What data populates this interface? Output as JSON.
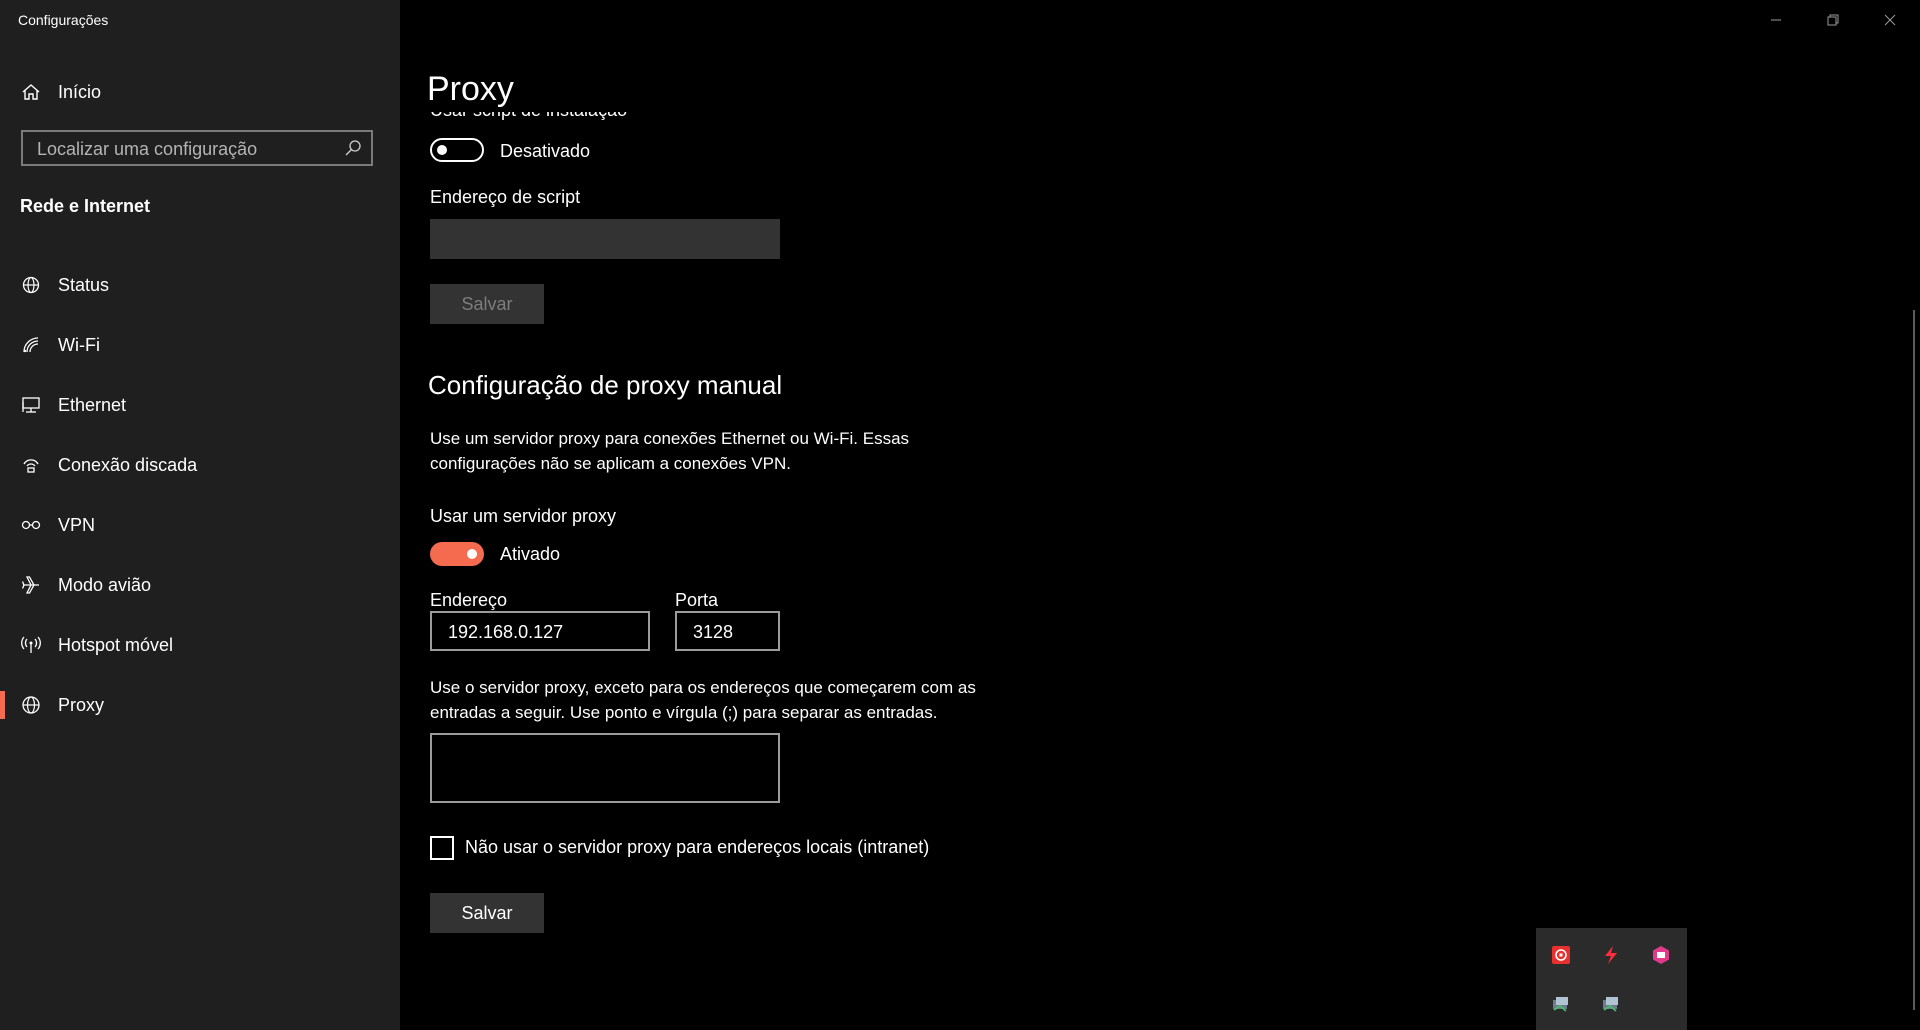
{
  "window": {
    "title": "Configurações"
  },
  "sidebar": {
    "home_label": "Início",
    "search_placeholder": "Localizar uma configuração",
    "section_title": "Rede e Internet",
    "items": [
      {
        "label": "Status",
        "icon": "globe-status-icon"
      },
      {
        "label": "Wi-Fi",
        "icon": "wifi-icon"
      },
      {
        "label": "Ethernet",
        "icon": "ethernet-icon"
      },
      {
        "label": "Conexão discada",
        "icon": "dialup-icon"
      },
      {
        "label": "VPN",
        "icon": "vpn-icon"
      },
      {
        "label": "Modo avião",
        "icon": "airplane-icon"
      },
      {
        "label": "Hotspot móvel",
        "icon": "hotspot-icon"
      },
      {
        "label": "Proxy",
        "icon": "globe-icon",
        "active": true
      }
    ]
  },
  "content": {
    "page_title": "Proxy",
    "script": {
      "clipped_label": "Usar script de instalação",
      "toggle_state": "Desativado",
      "address_label": "Endereço de script",
      "address_value": "",
      "save_label": "Salvar"
    },
    "manual": {
      "heading": "Configuração de proxy manual",
      "description": "Use um servidor proxy para conexões Ethernet ou Wi-Fi. Essas configurações não se aplicam a conexões VPN.",
      "use_proxy_label": "Usar um servidor proxy",
      "toggle_state": "Ativado",
      "address_label": "Endereço",
      "address_value": "192.168.0.127",
      "port_label": "Porta",
      "port_value": "3128",
      "exceptions_description": "Use o servidor proxy, exceto para os endereços que começarem com as entradas a seguir. Use ponto e vírgula (;) para separar as entradas.",
      "exceptions_value": "",
      "local_checkbox_label": "Não usar o servidor proxy para endereços locais (intranet)",
      "local_checkbox_checked": false,
      "save_label": "Salvar"
    }
  },
  "colors": {
    "accent": "#f46b4f",
    "sidebar_bg": "#1f1f1f",
    "content_bg": "#000000"
  },
  "tray_icons": [
    "red-app-icon",
    "lightning-icon",
    "pink-app-icon",
    "network-app-icon",
    "network-app-icon-2"
  ]
}
